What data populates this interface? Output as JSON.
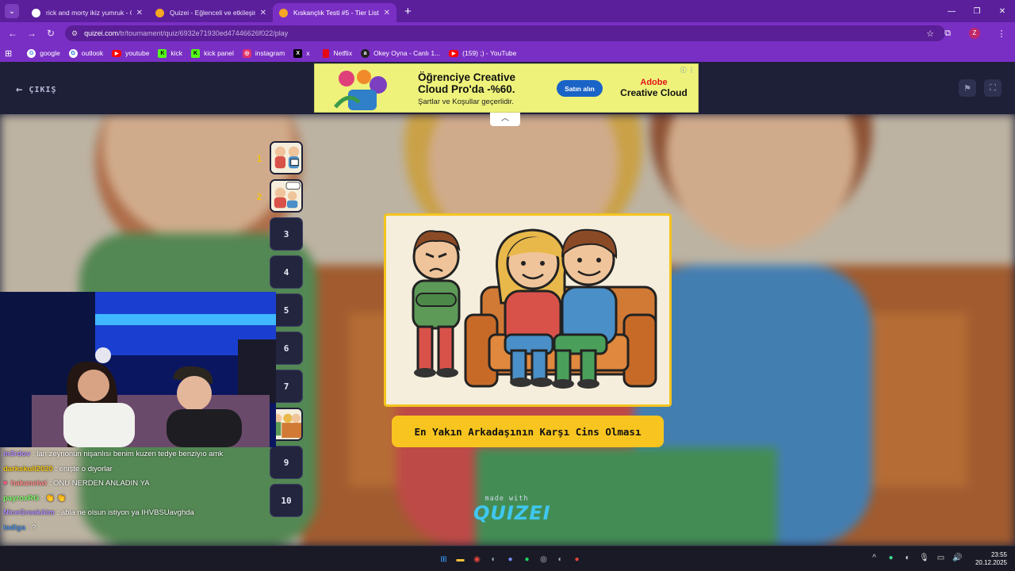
{
  "browser": {
    "tabs": [
      {
        "title": "rick and morty ikiz yumruk - Go",
        "active": false,
        "favicon": "google-icon",
        "color": "#ffffff"
      },
      {
        "title": "Quizei - Eğlenceli ve etkileşimli",
        "active": false,
        "favicon": "quizei-icon",
        "color": "#f5a623"
      },
      {
        "title": "Kıskançlık Testi #5 - Tier List, Kı",
        "active": true,
        "favicon": "quizei-icon",
        "color": "#f5a623"
      }
    ],
    "url_host": "quizei.com",
    "url_path": "/tr/tournament/quiz/6932e71930ed47446626f022/play",
    "profile_initial": "Z",
    "bookmarks": [
      {
        "label": "google",
        "icon": "google-icon",
        "color": "#ffffff"
      },
      {
        "label": "outlook",
        "icon": "outlook-icon",
        "color": "#ffffff"
      },
      {
        "label": "youtube",
        "icon": "youtube-icon",
        "color": "#ff0000"
      },
      {
        "label": "kick",
        "icon": "kick-icon",
        "color": "#53fc18"
      },
      {
        "label": "kick panel",
        "icon": "kick-icon",
        "color": "#53fc18"
      },
      {
        "label": "instagram",
        "icon": "instagram-icon",
        "color": "#e1306c"
      },
      {
        "label": "x",
        "icon": "x-icon",
        "color": "#000000"
      },
      {
        "label": "Netflix",
        "icon": "netflix-icon",
        "color": "#e50914"
      },
      {
        "label": "Okey Oyna - Canlı 1...",
        "icon": "okey-icon",
        "color": "#222222"
      },
      {
        "label": "(159) ;) - YouTube",
        "icon": "youtube-icon",
        "color": "#ff0000"
      }
    ]
  },
  "quiz": {
    "exit_label": "ÇIKIŞ",
    "caption": "En Yakın Arkadaşının Karşı Cins Olması",
    "made_with": "made with",
    "brand": "QUIZEI",
    "accent": "#f8c41f",
    "rounds": [
      {
        "label": "1",
        "has_image": true
      },
      {
        "label": "2",
        "has_image": true
      },
      {
        "label": "3",
        "has_image": false
      },
      {
        "label": "4",
        "has_image": false
      },
      {
        "label": "5",
        "has_image": false
      },
      {
        "label": "6",
        "has_image": false
      },
      {
        "label": "7",
        "has_image": false
      },
      {
        "label": "8",
        "has_image": true
      },
      {
        "label": "9",
        "has_image": false
      },
      {
        "label": "10",
        "has_image": false
      }
    ],
    "round_markers": [
      "1",
      "2"
    ]
  },
  "ad": {
    "title": "Öğrenciye Creative Cloud Pro'da -%60.",
    "subtitle": "Şartlar ve Koşullar geçerlidir.",
    "button": "Satın alın",
    "brand_line1": "Adobe",
    "brand_line2": "Creative Cloud"
  },
  "chat": [
    {
      "user": "m3rdov",
      "color": "#b28bff",
      "msg": " : lan zeynonun nişanlısı benim kuzen tedye benziyıo amk"
    },
    {
      "user": "darkskull2020",
      "color": "#f1c40f",
      "msg": " : enişte o diyorlar"
    },
    {
      "user": "hakanelwi",
      "color": "#ff8a8a",
      "msg": " : ONU NERDEN ANLADIN YA"
    },
    {
      "user": "payroxRG",
      "color": "#7dff6a",
      "msg": " : 👏 👏"
    },
    {
      "user": "NiceGreekAim",
      "color": "#b28bff",
      "msg": " : abla ne olsun istiyon ya IHVBSUavghda"
    },
    {
      "user": "tadiga",
      "color": "#4a90e2",
      "msg": " : ?"
    }
  ],
  "taskbar": {
    "time": "23:55",
    "date": "20.12.2025"
  }
}
